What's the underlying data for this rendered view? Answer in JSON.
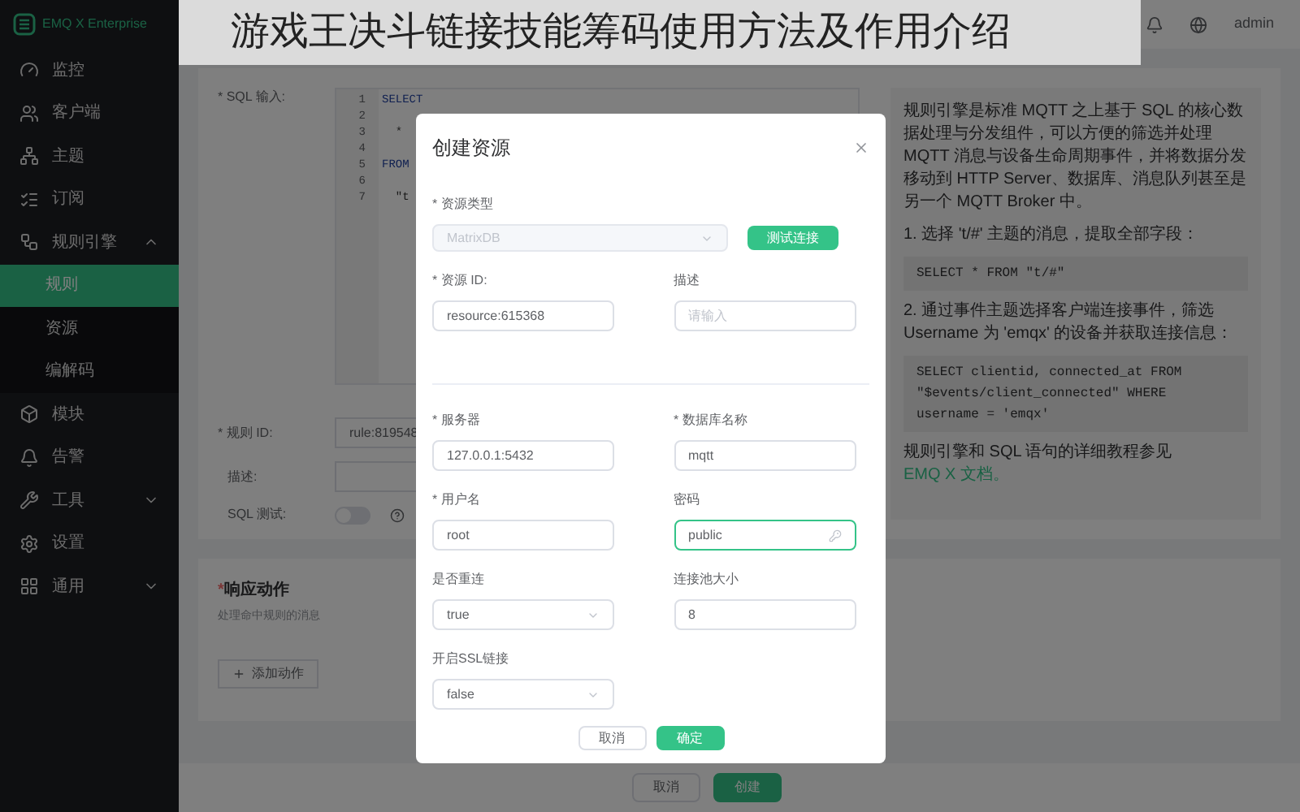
{
  "banner": {
    "title": "游戏王决斗链接技能筹码使用方法及作用介绍"
  },
  "sidebar": {
    "logo": "EMQ X Enterprise",
    "items": [
      {
        "label": "监控",
        "kind": "link"
      },
      {
        "label": "客户端",
        "kind": "link"
      },
      {
        "label": "主题",
        "kind": "link"
      },
      {
        "label": "订阅",
        "kind": "link"
      },
      {
        "label": "规则引擎",
        "kind": "group",
        "expanded": true,
        "children": [
          {
            "label": "规则",
            "selected": true
          },
          {
            "label": "资源",
            "selected": false
          },
          {
            "label": "编解码",
            "selected": false
          }
        ]
      },
      {
        "label": "模块",
        "kind": "link"
      },
      {
        "label": "告警",
        "kind": "link"
      },
      {
        "label": "工具",
        "kind": "group",
        "expanded": false
      },
      {
        "label": "设置",
        "kind": "link"
      },
      {
        "label": "通用",
        "kind": "group",
        "expanded": false
      }
    ]
  },
  "header": {
    "user": "admin"
  },
  "rule_form": {
    "sql_label": "SQL 输入:",
    "code_lines": [
      {
        "number": "1",
        "code": "SELECT",
        "kind": "keyword"
      },
      {
        "number": "2"
      },
      {
        "number": "3",
        "code": "  *",
        "kind": "plain"
      },
      {
        "number": "4"
      },
      {
        "number": "5",
        "code": "FROM",
        "kind": "keyword"
      },
      {
        "number": "6"
      },
      {
        "number": "7",
        "code": "  \"t",
        "kind": "plain"
      }
    ],
    "id_label": "规则 ID:",
    "id_value": "rule:819548",
    "desc_label": "描述:",
    "test_label": "SQL 测试:",
    "test_on": false
  },
  "help": [
    {
      "kind": "text",
      "text": "规则引擎是标准 MQTT 之上基于 SQL 的核心数据处理与分发组件，可以方便的筛选并处理 MQTT 消息与设备生命周期事件，并将数据分发移动到 HTTP Server、数据库、消息队列甚至是另一个 MQTT Broker 中。"
    },
    {
      "kind": "text",
      "text": "1. 选择 't/#' 主题的消息，提取全部字段："
    },
    {
      "kind": "code",
      "text": "SELECT * FROM \"t/#\""
    },
    {
      "kind": "text",
      "text": "2. 通过事件主题选择客户端连接事件，筛选 Username 为 'emqx' 的设备并获取连接信息："
    },
    {
      "kind": "code",
      "text": "SELECT clientid, connected_at FROM \"$events/client_connected\" WHERE username = 'emqx'"
    },
    {
      "kind": "link_text",
      "text": "规则引擎和 SQL 语句的详细教程参见",
      "link": "EMQ X 文档。"
    }
  ],
  "actions_card": {
    "title": "响应动作",
    "subtitle": "处理命中规则的消息",
    "add_button": "添加动作"
  },
  "footer": {
    "buttons": [
      {
        "label": "取消",
        "primary": false
      },
      {
        "label": "创建",
        "primary": true
      }
    ]
  },
  "dialog": {
    "title": "创建资源",
    "type_label": "资源类型",
    "type_value": "MatrixDB",
    "type_disabled": true,
    "test_button": "测试连接",
    "top_fields": [
      {
        "label": "资源 ID:",
        "required": true,
        "kind": "input",
        "value": "resource:615368",
        "focused": false
      },
      {
        "label": "描述",
        "required": false,
        "kind": "input",
        "placeholder": "请输入",
        "focused": false
      }
    ],
    "fields": [
      {
        "label": "服务器",
        "required": true,
        "kind": "input",
        "value": "127.0.0.1:5432",
        "focused": false
      },
      {
        "label": "数据库名称",
        "required": true,
        "kind": "input",
        "value": "mqtt",
        "focused": false
      },
      {
        "label": "用户名",
        "required": true,
        "kind": "input",
        "value": "root",
        "focused": false
      },
      {
        "label": "密码",
        "required": false,
        "kind": "password",
        "value": "public",
        "focused": true
      },
      {
        "label": "是否重连",
        "required": false,
        "kind": "select",
        "value": "true",
        "focused": false
      },
      {
        "label": "连接池大小",
        "required": false,
        "kind": "input",
        "value": "8",
        "focused": false
      },
      {
        "label": "开启SSL链接",
        "required": false,
        "kind": "select",
        "value": "false",
        "focused": false
      }
    ],
    "buttons": [
      {
        "label": "取消",
        "primary": false
      },
      {
        "label": "确定",
        "primary": true
      }
    ]
  }
}
